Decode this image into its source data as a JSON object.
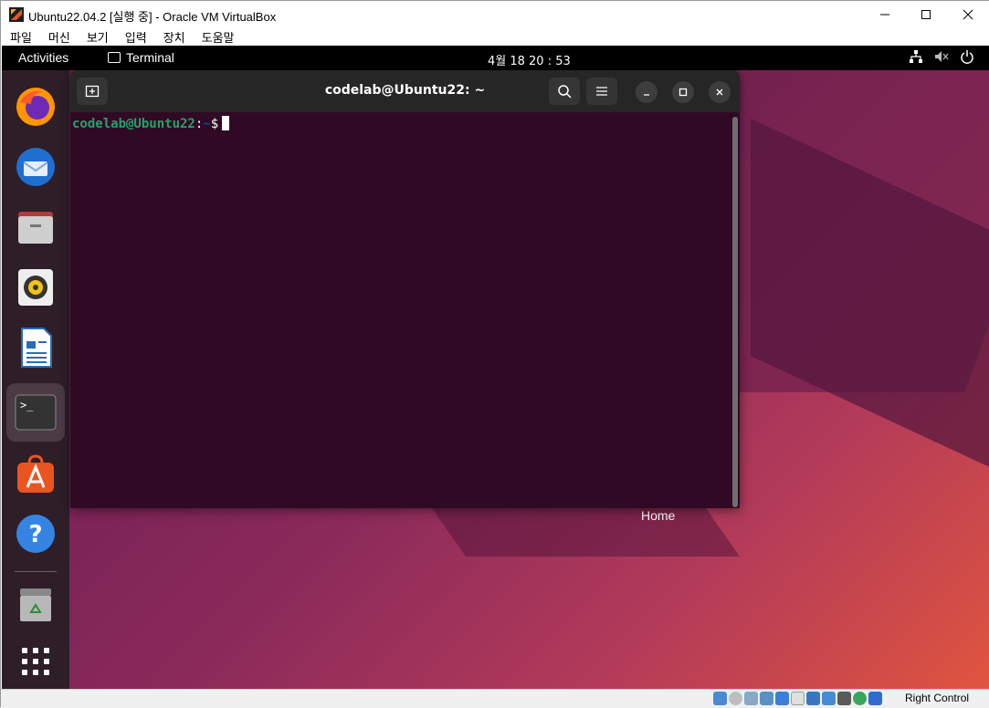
{
  "vbox": {
    "title": "Ubuntu22.04.2 [실행 중] - Oracle VM VirtualBox",
    "menu": [
      "파일",
      "머신",
      "보기",
      "입력",
      "장치",
      "도움말"
    ],
    "host_key": "Right Control"
  },
  "topbar": {
    "activities": "Activities",
    "app_name": "Terminal",
    "clock": "4월 18  20 : 53"
  },
  "dock": {
    "items": [
      "firefox-icon",
      "thunderbird-icon",
      "files-icon",
      "rhythmbox-icon",
      "libreoffice-writer-icon",
      "terminal-icon",
      "app-center-icon",
      "help-icon",
      "trash-icon",
      "show-apps-icon"
    ],
    "active": "terminal-icon"
  },
  "desktop": {
    "home_label": "Home"
  },
  "terminal": {
    "title": "codelab@Ubuntu22: ~",
    "prompt_user": "codelab@Ubuntu22",
    "prompt_sep": ":",
    "prompt_path": "~",
    "prompt_symbol": "$"
  },
  "colors": {
    "terminal_bg": "#300a24",
    "prompt_user": "#26a269",
    "prompt_path": "#12488b",
    "ubuntu_orange": "#e95420"
  }
}
